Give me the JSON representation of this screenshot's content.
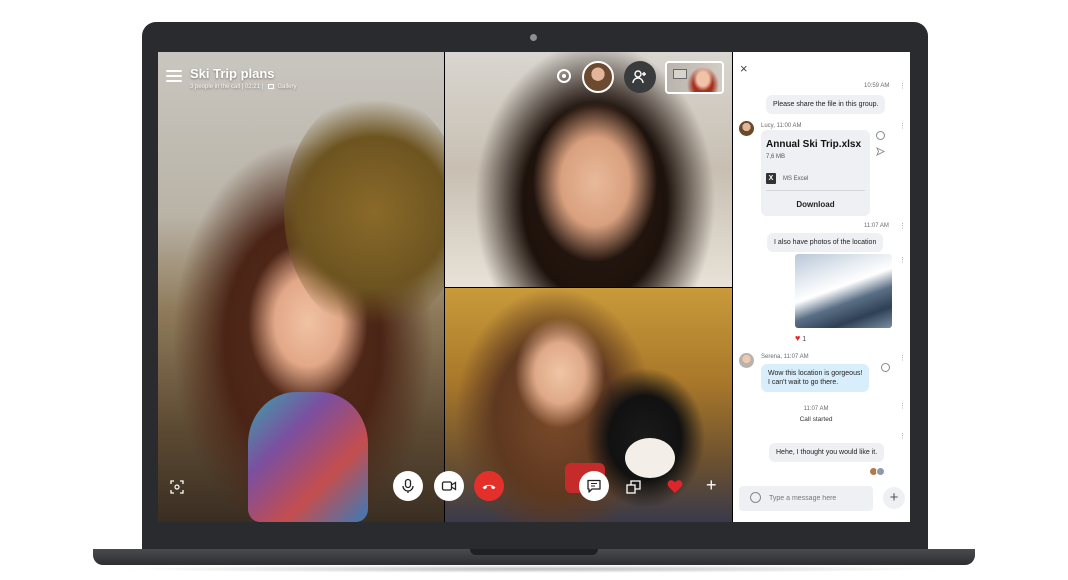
{
  "call": {
    "title": "Ski Trip plans",
    "subtitle": "3 people in the call | 02:21 |",
    "gallery_label": "Gallery"
  },
  "chat": {
    "messages": [
      {
        "time": "10:59 AM",
        "text": "Please share the file in this group."
      },
      {
        "sender_meta": "Lucy, 11:00 AM",
        "file": {
          "name": "Annual Ski Trip.xlsx",
          "size": "7,6 MB",
          "type": "MS Excel",
          "action": "Download"
        }
      },
      {
        "time": "11:07 AM",
        "text": "I also have photos of the location",
        "reaction_count": "1"
      },
      {
        "sender_meta": "Serena, 11:07 AM",
        "text_line1": "Wow this location is gorgeous!",
        "text_line2": "I can't wait to go there."
      },
      {
        "time": "11:07 AM",
        "event": "Call started"
      },
      {
        "text": "Hehe, I thought you would like it."
      }
    ],
    "input_placeholder": "Type a message here"
  },
  "icons": {
    "close": "×",
    "plus": "+",
    "more": "⋮",
    "excel": "X"
  },
  "colors": {
    "end_call": "#e3302a",
    "heart": "#e0242b",
    "bubble_self": "#eef0f3",
    "bubble_other": "#d8eefb"
  }
}
